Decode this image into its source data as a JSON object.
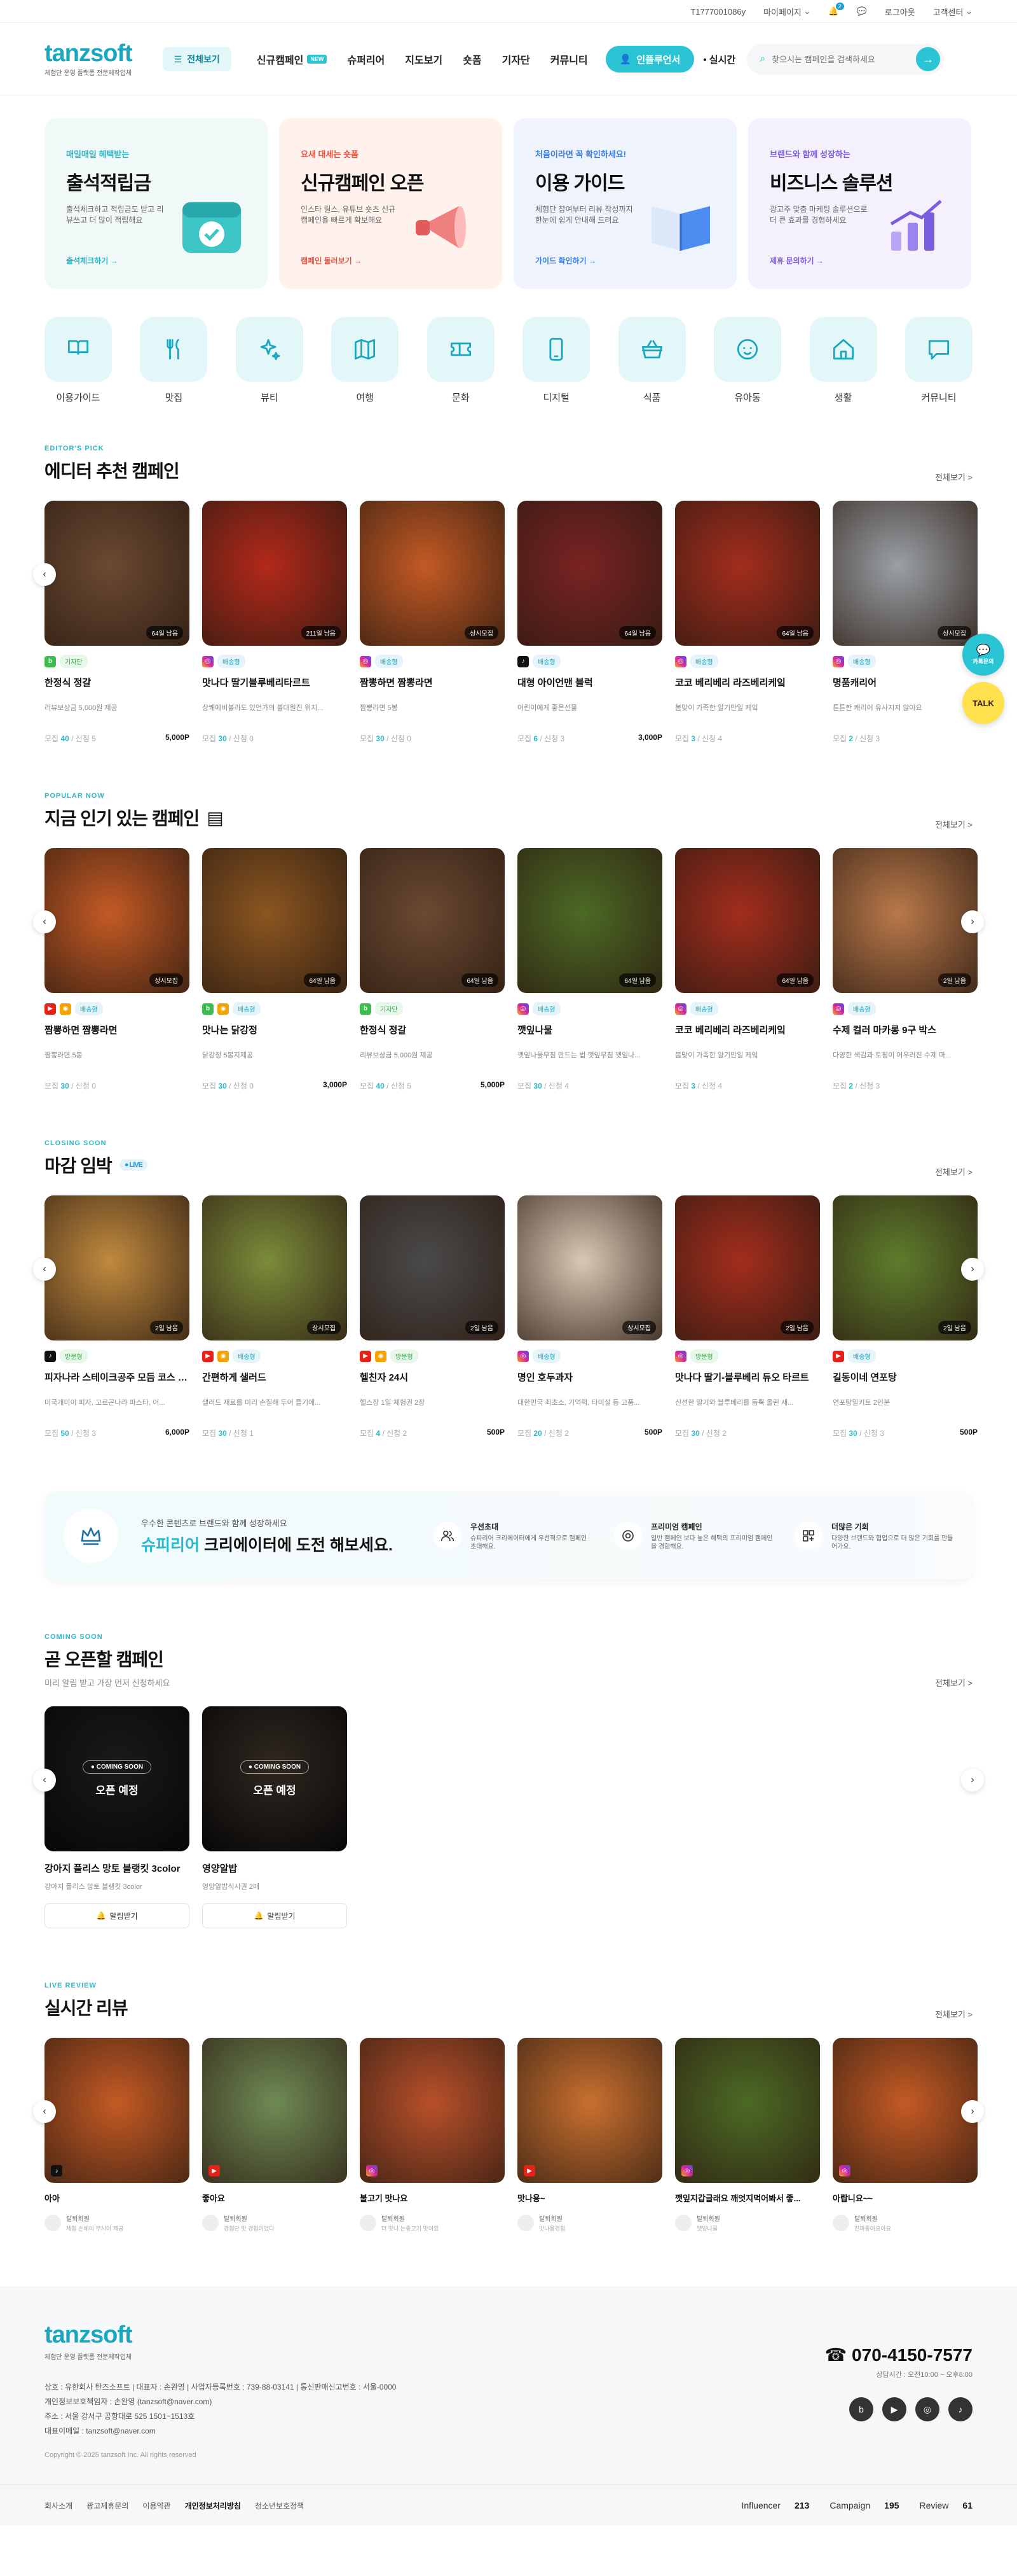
{
  "topbar": {
    "phone": "T1777001086y",
    "mypage": "마이페이지",
    "logout": "로그아웃",
    "support": "고객센터",
    "notice_count": "2"
  },
  "header": {
    "logo": "tanzsoft",
    "logo_sub": "체험단 운영 플랫폼 전문제작업체",
    "all_menu": "전체보기",
    "nav": [
      {
        "label": "신규캠페인",
        "badge": "NEW"
      },
      {
        "label": "슈퍼리어"
      },
      {
        "label": "지도보기"
      },
      {
        "label": "숏폼"
      },
      {
        "label": "기자단"
      },
      {
        "label": "커뮤니티"
      }
    ],
    "influencer_btn": "인플루언서",
    "live_label": "• 실시간",
    "search_placeholder": "찾으시는 캠페인을 검색하세요"
  },
  "banners": [
    {
      "kicker": "매일매일 혜택받는",
      "title": "출석적립금",
      "desc": "출석체크하고 적립금도 받고 리뷰쓰고 더 많이 적립해요",
      "link": "출석체크하기 →",
      "bg": "#f1f8f8",
      "kc": "#2bb8c8"
    },
    {
      "kicker": "요새 대세는 숏폼",
      "title": "신규캠페인 오픈",
      "desc": "인스타 릴스, 유튜브 숏츠 신규 캠페인을 빠르게 확보해요",
      "link": "캠페인 둘러보기 →",
      "bg": "#fff2ed",
      "kc": "#e9543f"
    },
    {
      "kicker": "처음이라면 꼭 확인하세요!",
      "title": "이용 가이드",
      "desc": "체험단 참여부터 리뷰 작성까지 한눈에 쉽게 안내해 드려요",
      "link": "가이드 확인하기 →",
      "bg": "#eef3fc",
      "kc": "#3c7ee0"
    },
    {
      "kicker": "브랜드와 함께 성장하는",
      "title": "비즈니스 솔루션",
      "desc": "광고주 맞춤 마케팅 솔루션으로 더 큰 효과를 경험하세요",
      "link": "제휴 문의하기 →",
      "bg": "#f4f1fd",
      "kc": "#7a5cdf"
    }
  ],
  "categories": [
    {
      "label": "이용가이드",
      "icon": "book-icon"
    },
    {
      "label": "맛집",
      "icon": "fork-knife-icon"
    },
    {
      "label": "뷰티",
      "icon": "sparkle-icon"
    },
    {
      "label": "여행",
      "icon": "map-icon"
    },
    {
      "label": "문화",
      "icon": "ticket-icon"
    },
    {
      "label": "디지털",
      "icon": "phone-icon"
    },
    {
      "label": "식품",
      "icon": "basket-icon"
    },
    {
      "label": "유아동",
      "icon": "baby-icon"
    },
    {
      "label": "생활",
      "icon": "home-icon"
    },
    {
      "label": "커뮤니티",
      "icon": "chat-icon"
    }
  ],
  "editor": {
    "eyebrow": "EDITOR'S PICK",
    "title": "에디터 추천 캠페인",
    "more": "전체보기 >",
    "items": [
      {
        "tag": "64일 남음",
        "plats": [
          "b"
        ],
        "label": "기자단",
        "lc": "green",
        "title": "한정식 정갈",
        "desc": "리뷰보상금 5,000원 제공",
        "recruit": "40",
        "apply": "신청 5",
        "point": "5,000P",
        "img": "#6b4a32"
      },
      {
        "tag": "211일 남음",
        "plats": [
          "i"
        ],
        "label": "배송형",
        "lc": "blue",
        "title": "맛나다 딸기블루베리타르트",
        "desc": "상쾌에비불라도 있언가의 블대원진 위치...",
        "recruit": "30",
        "apply": "신청 0",
        "point": "",
        "img": "#b3291a"
      },
      {
        "tag": "상시모집",
        "plats": [
          "i"
        ],
        "label": "배송형",
        "lc": "blue",
        "title": "짬뽕하면 짬뽕라면",
        "desc": "짬뽕라면 5봉",
        "recruit": "30",
        "apply": "신청 0",
        "point": "",
        "img": "#c45a24"
      },
      {
        "tag": "64일 남음",
        "plats": [
          "t"
        ],
        "label": "배송형",
        "lc": "blue",
        "title": "대형 아이언맨 블럭",
        "desc": "어린이에게 좋은선물",
        "recruit": "6",
        "apply": "신청 3",
        "point": "3,000P",
        "img": "#7a2323"
      },
      {
        "tag": "64일 남음",
        "plats": [
          "i"
        ],
        "label": "배송형",
        "lc": "blue",
        "title": "코코 베리베리 라즈베리케잌",
        "desc": "봄맞이 가족한 알기만일 케잌",
        "recruit": "3",
        "apply": "신청 4",
        "point": "",
        "img": "#a32d1d"
      },
      {
        "tag": "상시모집",
        "plats": [
          "i"
        ],
        "label": "배송형",
        "lc": "blue",
        "title": "명품캐리어",
        "desc": "튼튼한 캐리어 유사지지 않아요",
        "recruit": "2",
        "apply": "신청 3",
        "point": "",
        "img": "#9aa0a6"
      }
    ]
  },
  "popular": {
    "eyebrow": "POPULAR NOW",
    "title": "지금 인기 있는 캠페인",
    "more": "전체보기 >",
    "items": [
      {
        "tag": "상시모집",
        "plats": [
          "y",
          "o"
        ],
        "label": "배송형",
        "lc": "blue",
        "title": "짬뽕하면 짬뽕라면",
        "desc": "짬뽕라면 5봉",
        "recruit": "30",
        "apply": "신청 0",
        "point": "",
        "img": "#c45a24"
      },
      {
        "tag": "64일 남음",
        "plats": [
          "b",
          "o"
        ],
        "label": "배송형",
        "lc": "blue",
        "title": "맛나는 닭강정",
        "desc": "닭강정 5봉지제공",
        "recruit": "30",
        "apply": "신청 0",
        "point": "3,000P",
        "img": "#8b5620"
      },
      {
        "tag": "64일 남음",
        "plats": [
          "b"
        ],
        "label": "기자단",
        "lc": "green",
        "title": "한정식 정갈",
        "desc": "리뷰보상금 5,000원 제공",
        "recruit": "40",
        "apply": "신청 5",
        "point": "5,000P",
        "img": "#6b4a32"
      },
      {
        "tag": "64일 남음",
        "plats": [
          "i"
        ],
        "label": "배송형",
        "lc": "blue",
        "title": "깻잎나물",
        "desc": "깻잎나물무침 만드는 법 깻잎무침 깻잎나...",
        "recruit": "30",
        "apply": "신청 4",
        "point": "",
        "img": "#4c6a24"
      },
      {
        "tag": "64일 남음",
        "plats": [
          "i"
        ],
        "label": "배송형",
        "lc": "blue",
        "title": "코코 베리베리 라즈베리케잌",
        "desc": "봄맞이 가족한 알기만일 케잌",
        "recruit": "3",
        "apply": "신청 4",
        "point": "",
        "img": "#a32d1d"
      },
      {
        "tag": "2일 남음",
        "plats": [
          "i"
        ],
        "label": "배송형",
        "lc": "blue",
        "title": "수제 컬러 마카롱 9구 박스",
        "desc": "다양한 색감과 토핑이 어우러진 수제 마...",
        "recruit": "2",
        "apply": "신청 3",
        "point": "",
        "img": "#b9794a"
      }
    ]
  },
  "closing": {
    "eyebrow": "CLOSING SOON",
    "title": "마감 임박",
    "live": "● LIVE",
    "more": "전체보기 >",
    "items": [
      {
        "tag": "2일 남음",
        "plats": [
          "t"
        ],
        "label": "방문형",
        "lc": "green",
        "title": "피자나라 스테이크공주 모듬 코스 (피자-파스타-치킨스테이크)",
        "desc": "미국개미이 피자, 고르곤나라 파스타, 어...",
        "recruit": "50",
        "apply": "신청 3",
        "point": "6,000P",
        "img": "#c08a3e"
      },
      {
        "tag": "상시모집",
        "plats": [
          "y",
          "o"
        ],
        "label": "배송형",
        "lc": "blue",
        "title": "간편하게 샐러드",
        "desc": "샐러드 재료를 미리 손질해 두어 들기에...",
        "recruit": "30",
        "apply": "신청 1",
        "point": "",
        "img": "#7b8c3a"
      },
      {
        "tag": "2일 남음",
        "plats": [
          "y",
          "o"
        ],
        "label": "방문형",
        "lc": "green",
        "title": "헬친자 24시",
        "desc": "헬스장 1일 체험권 2장",
        "recruit": "4",
        "apply": "신청 2",
        "point": "500P",
        "img": "#4a4a4a"
      },
      {
        "tag": "상시모집",
        "plats": [
          "i"
        ],
        "label": "배송형",
        "lc": "blue",
        "title": "명인 호두과자",
        "desc": "대한민국 최초소, 기억력, 타미설 등 고품...",
        "recruit": "20",
        "apply": "신청 2",
        "point": "500P",
        "img": "#d8c8b4"
      },
      {
        "tag": "2일 남음",
        "plats": [
          "i"
        ],
        "label": "방문형",
        "lc": "green",
        "title": "맛나다 딸기-블루베리 듀오 타르트",
        "desc": "신선한 딸기와 블루베리를 듬뿍 올린 새...",
        "recruit": "30",
        "apply": "신청 2",
        "point": "",
        "img": "#a32d1d"
      },
      {
        "tag": "2일 남음",
        "plats": [
          "y"
        ],
        "label": "배송형",
        "lc": "blue",
        "title": "길동이네 연포탕",
        "desc": "연포탕밀키트 2인분",
        "recruit": "30",
        "apply": "신청 3",
        "point": "500P",
        "img": "#5e7d2c"
      }
    ]
  },
  "promo": {
    "small": "우수한 콘텐츠로 브랜드와 함께 성장하세요",
    "big_hl": "슈피리어",
    "big_rest": " 크리에이터에 도전 해보세요.",
    "features": [
      {
        "title": "우선초대",
        "desc": "슈피리어 크리에이터에게 우선적으로 캠페인 초대해요.",
        "icon": "users-icon"
      },
      {
        "title": "프리미엄 캠페인",
        "desc": "일반 캠페인 보다 높은 혜택의 프리미엄 캠페인을 경험해요.",
        "icon": "target-icon"
      },
      {
        "title": "더많은 기회",
        "desc": "다양한 브랜드와 협업으로 더 많은 기회를 만들어가요.",
        "icon": "grid-icon"
      }
    ]
  },
  "coming": {
    "eyebrow": "COMING SOON",
    "title": "곧 오픈할 캠페인",
    "sub": "미리 알림 받고 가장 먼저 신청하세요",
    "more": "전체보기 >",
    "items": [
      {
        "pill": "● COMING SOON",
        "open": "오픈 예정",
        "title": "강아지 플리스 망토 블랭킷 3color",
        "desc": "강아지 플리스 망토 블랭킷 3color",
        "btn": "알림받기",
        "img": "#3a3a3a"
      },
      {
        "pill": "● COMING SOON",
        "open": "오픈 예정",
        "title": "영양알밥",
        "desc": "영양알밥식사권 2매",
        "btn": "알림받기",
        "img": "#6a5848"
      }
    ]
  },
  "reviews": {
    "eyebrow": "LIVE REVIEW",
    "title": "실시간 리뷰",
    "more": "전체보기 >",
    "items": [
      {
        "title": "아아",
        "user": "탈퇴회원",
        "date": "체험 손해이 무시어 제공",
        "img": "#c45a24",
        "plat": "t"
      },
      {
        "title": "좋아요",
        "user": "탈퇴회원",
        "date": "경험단 맛 경험이었다",
        "img": "#6e8a54",
        "plat": "y"
      },
      {
        "title": "불고기 맛나요",
        "user": "탈퇴회원",
        "date": "더 맛나 는좋고기 맛이있",
        "img": "#b8502a",
        "plat": "i"
      },
      {
        "title": "맛나용~",
        "user": "탈퇴회원",
        "date": "맛나용경험",
        "img": "#c9702f",
        "plat": "y"
      },
      {
        "title": "깻잎지갑글래요 깨엇지먹어봐서 좋...",
        "user": "탈퇴회원",
        "date": "깻잎나물",
        "img": "#4c6a24",
        "plat": "i"
      },
      {
        "title": "아랍니요~~",
        "user": "탈퇴회원",
        "date": "진짜좋아요아요",
        "img": "#c45a24",
        "plat": "i"
      }
    ]
  },
  "footer": {
    "logo": "tanzsoft",
    "sub": "체험단 운영 플랫폼 전문제작업체",
    "info": [
      "상호 : 유한회사 탄즈소프트  |  대표자 : 손완영  |  사업자등록번호 : 739-88-03141  |  통신판매신고번호 : 서울-0000",
      "개인정보보호책임자 : 손완영 (tanzsoft@naver.com)",
      "주소 : 서울 강서구 공항대로 525 1501~1513호",
      "대표이메일 : tanzsoft@naver.com"
    ],
    "copyright": "Copyright © 2025 tanzsoft Inc. All rights reserved",
    "phone": "070-4150-7577",
    "hours": "상담시간 : 오전10:00 ~ 오후6:00",
    "links": [
      "회사소개",
      "광고제휴문의",
      "이용약관",
      "개인정보처리방침",
      "청소년보호정책"
    ],
    "stats": [
      {
        "k": "Influencer",
        "v": "213"
      },
      {
        "k": "Campaign",
        "v": "195"
      },
      {
        "k": "Review",
        "v": "61"
      }
    ]
  },
  "floating": {
    "chat": "카톡문의",
    "talk": "TALK"
  }
}
